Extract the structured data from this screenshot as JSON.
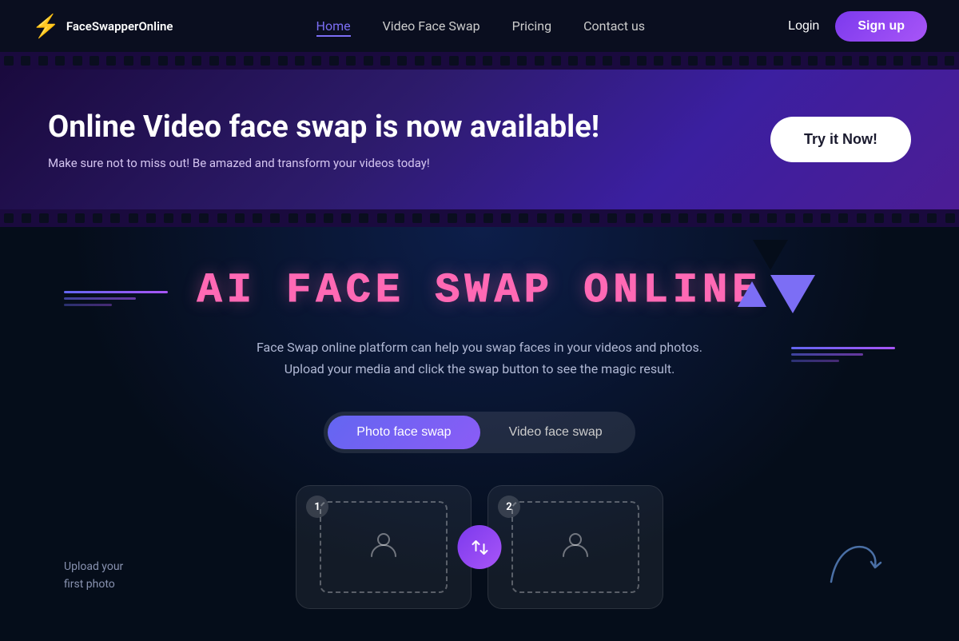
{
  "navbar": {
    "logo_text": "FaceSwapperOnline",
    "links": [
      {
        "label": "Home",
        "active": true
      },
      {
        "label": "Video Face Swap",
        "active": false
      },
      {
        "label": "Pricing",
        "active": false
      },
      {
        "label": "Contact us",
        "active": false
      }
    ],
    "login_label": "Login",
    "signup_label": "Sign up"
  },
  "hero": {
    "heading": "Online Video face swap is now available!",
    "subtext": "Make sure not to miss out! Be amazed and transform your videos today!",
    "cta_label": "Try it Now!"
  },
  "main": {
    "title": "AI FACE SWAP ONLINE",
    "description": "Face Swap online platform can help you swap faces in your videos and photos. Upload your media and click the swap button to see the magic result.",
    "tabs": [
      {
        "label": "Photo face swap",
        "active": true
      },
      {
        "label": "Video face swap",
        "active": false
      }
    ],
    "upload_label_line1": "Upload your",
    "upload_label_line2": "first photo",
    "card1_badge": "1",
    "card2_badge": "2"
  }
}
